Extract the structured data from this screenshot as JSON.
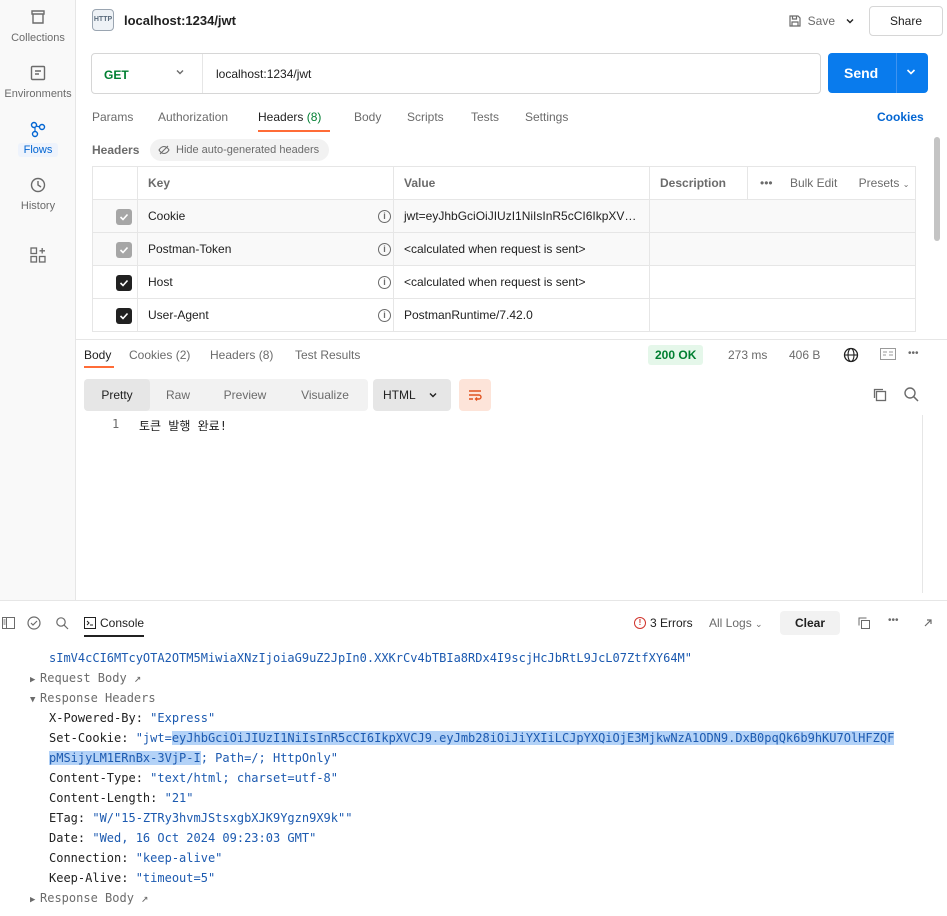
{
  "sidebar": {
    "items": [
      {
        "label": "Collections",
        "icon": "trash-icon"
      },
      {
        "label": "Environments",
        "icon": "environment-icon"
      },
      {
        "label": "Flows",
        "icon": "flows-icon",
        "active": true
      },
      {
        "label": "History",
        "icon": "history-icon"
      },
      {
        "label": "",
        "icon": "add-workspace-icon"
      }
    ]
  },
  "tab": {
    "title": "localhost:1234/jwt",
    "badge": "HTTP"
  },
  "toolbar": {
    "save_label": "Save",
    "share_label": "Share"
  },
  "request": {
    "method": "GET",
    "url": "localhost:1234/jwt",
    "send_label": "Send",
    "tabs": [
      {
        "label": "Params"
      },
      {
        "label": "Authorization"
      },
      {
        "label": "Headers",
        "count": "(8)",
        "active": true
      },
      {
        "label": "Body"
      },
      {
        "label": "Scripts"
      },
      {
        "label": "Tests"
      },
      {
        "label": "Settings"
      }
    ],
    "cookies_link": "Cookies"
  },
  "headers_section": {
    "title": "Headers",
    "hide_auto_label": "Hide auto-generated headers",
    "columns": {
      "key": "Key",
      "value": "Value",
      "description": "Description",
      "bulk_edit": "Bulk Edit",
      "presets": "Presets"
    },
    "rows": [
      {
        "key": "Cookie",
        "value": "jwt=eyJhbGciOiJIUzI1NiIsInR5cCI6IkpXVCJ9...",
        "checked": "grey"
      },
      {
        "key": "Postman-Token",
        "value": "<calculated when request is sent>",
        "checked": "grey"
      },
      {
        "key": "Host",
        "value": "<calculated when request is sent>",
        "checked": "dark"
      },
      {
        "key": "User-Agent",
        "value": "PostmanRuntime/7.42.0",
        "checked": "dark"
      }
    ]
  },
  "response": {
    "tabs": [
      {
        "label": "Body",
        "active": true
      },
      {
        "label": "Cookies",
        "count": "(2)"
      },
      {
        "label": "Headers",
        "count": "(8)"
      },
      {
        "label": "Test Results"
      }
    ],
    "status": "200 OK",
    "time": "273 ms",
    "size": "406 B",
    "views": [
      "Pretty",
      "Raw",
      "Preview",
      "Visualize"
    ],
    "format": "HTML",
    "line_no": "1",
    "body_line": "토큰 발행 완료!"
  },
  "console": {
    "label": "Console",
    "errors": "3 Errors",
    "all_logs": "All Logs",
    "clear": "Clear",
    "token_line": "sImV4cCI6MTcyOTA2OTM5MiwiaXNzIjoiaG9uZ2JpIn0.XXKrCv4bTBIa8RDx4I9scjHcJbRtL9JcL07ZtfXY64M\"",
    "request_body": "Request Body",
    "response_headers": "Response Headers",
    "response_body": "Response Body",
    "headers": [
      {
        "k": "X-Powered-By: ",
        "v": "\"Express\""
      },
      {
        "k": "Set-Cookie: ",
        "v_pre": "\"jwt=",
        "v_hl1": "eyJhbGciOiJIUzI1NiIsInR5cCI6IkpXVCJ9.eyJmb28iOiJiYXIiLCJpYXQiOjE3MjkwNzA1ODN9.DxB0pqQk6b9hKU7OlHFZQF",
        "v_hl2": "pMSijyLM1ERnBx-3VjP-I",
        "v_post": "; Path=/; HttpOnly\""
      },
      {
        "k": "Content-Type: ",
        "v": "\"text/html; charset=utf-8\""
      },
      {
        "k": "Content-Length: ",
        "v": "\"21\""
      },
      {
        "k": "ETag: ",
        "v": "\"W/\"15-ZTRy3hvmJStsxgbXJK9Ygzn9X9k\"\""
      },
      {
        "k": "Date: ",
        "v": "\"Wed, 16 Oct 2024 09:23:03 GMT\""
      },
      {
        "k": "Connection: ",
        "v": "\"keep-alive\""
      },
      {
        "k": "Keep-Alive: ",
        "v": "\"timeout=5\""
      }
    ]
  }
}
